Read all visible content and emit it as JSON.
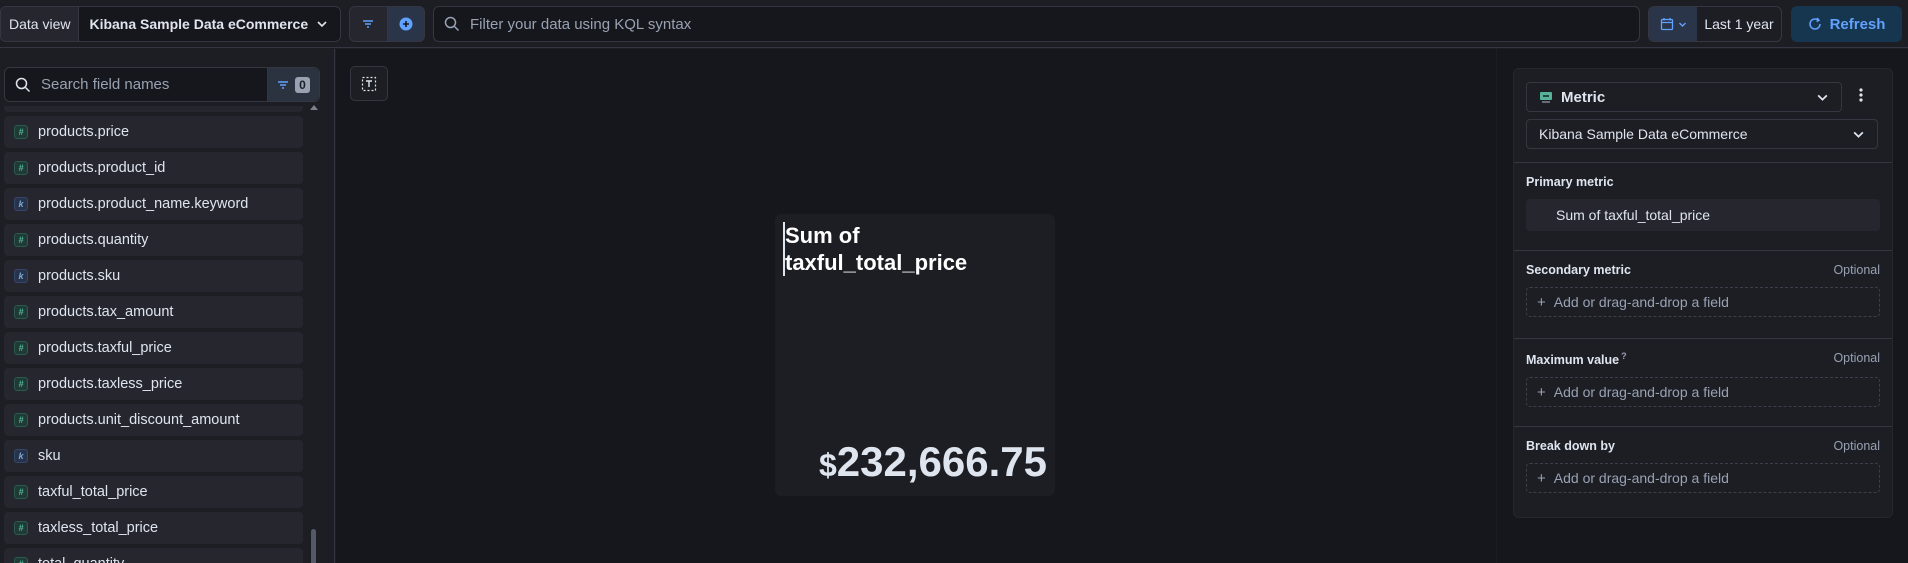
{
  "topbar": {
    "data_view_label": "Data view",
    "data_view_name": "Kibana Sample Data eCommerce",
    "kql_placeholder": "Filter your data using KQL syntax",
    "date_range": "Last 1 year",
    "refresh_label": "Refresh"
  },
  "fields": {
    "search_placeholder": "Search field names",
    "filter_count": "0",
    "items": [
      {
        "name": "products.price",
        "type": "number"
      },
      {
        "name": "products.product_id",
        "type": "number"
      },
      {
        "name": "products.product_name.keyword",
        "type": "keyword"
      },
      {
        "name": "products.quantity",
        "type": "number"
      },
      {
        "name": "products.sku",
        "type": "keyword"
      },
      {
        "name": "products.tax_amount",
        "type": "number"
      },
      {
        "name": "products.taxful_price",
        "type": "number"
      },
      {
        "name": "products.taxless_price",
        "type": "number"
      },
      {
        "name": "products.unit_discount_amount",
        "type": "number"
      },
      {
        "name": "sku",
        "type": "keyword"
      },
      {
        "name": "taxful_total_price",
        "type": "number"
      },
      {
        "name": "taxless_total_price",
        "type": "number"
      },
      {
        "name": "total_quantity",
        "type": "number"
      }
    ]
  },
  "metric": {
    "title_line1": "Sum of",
    "title_line2": "taxful_total_price",
    "currency": "$",
    "value": "232,666.75"
  },
  "config": {
    "viz_type": "Metric",
    "data_view": "Kibana Sample Data eCommerce",
    "primary_label": "Primary metric",
    "primary_value": "Sum of taxful_total_price",
    "secondary_label": "Secondary metric",
    "maximum_label": "Maximum value",
    "breakdown_label": "Break down by",
    "optional": "Optional",
    "add_field": "Add or drag-and-drop a field"
  },
  "colors": {
    "accent": "#61a2ff",
    "number_type": "#54b399",
    "keyword_type": "#79aad9"
  }
}
